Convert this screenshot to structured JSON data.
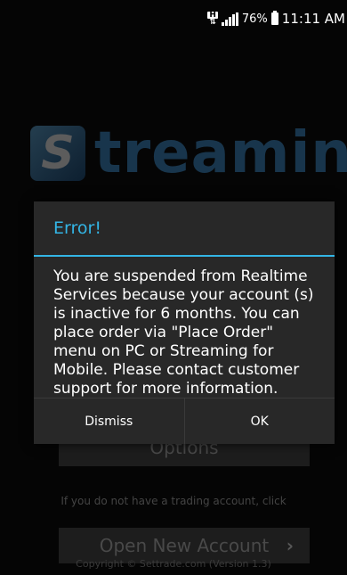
{
  "status_bar": {
    "network_label": "H",
    "battery": "76%",
    "time": "11:11 AM"
  },
  "background": {
    "logo_mark": "S",
    "logo_text": "treaming",
    "options_label": "Options",
    "hint": "If you do not have a trading account, click",
    "open_account_label": "Open New Account",
    "chevron": "›",
    "copyright": "Copyright © Settrade.com (Version 1.3)"
  },
  "dialog": {
    "title": "Error!",
    "title_color": "#33b5e5",
    "message": "You are suspended from Realtime Services because your account (s) is inactive for 6 months. You can place order via \"Place Order\" menu on PC or Streaming for Mobile. Please contact customer support for more information.",
    "dismiss_label": "Dismiss",
    "ok_label": "OK"
  }
}
